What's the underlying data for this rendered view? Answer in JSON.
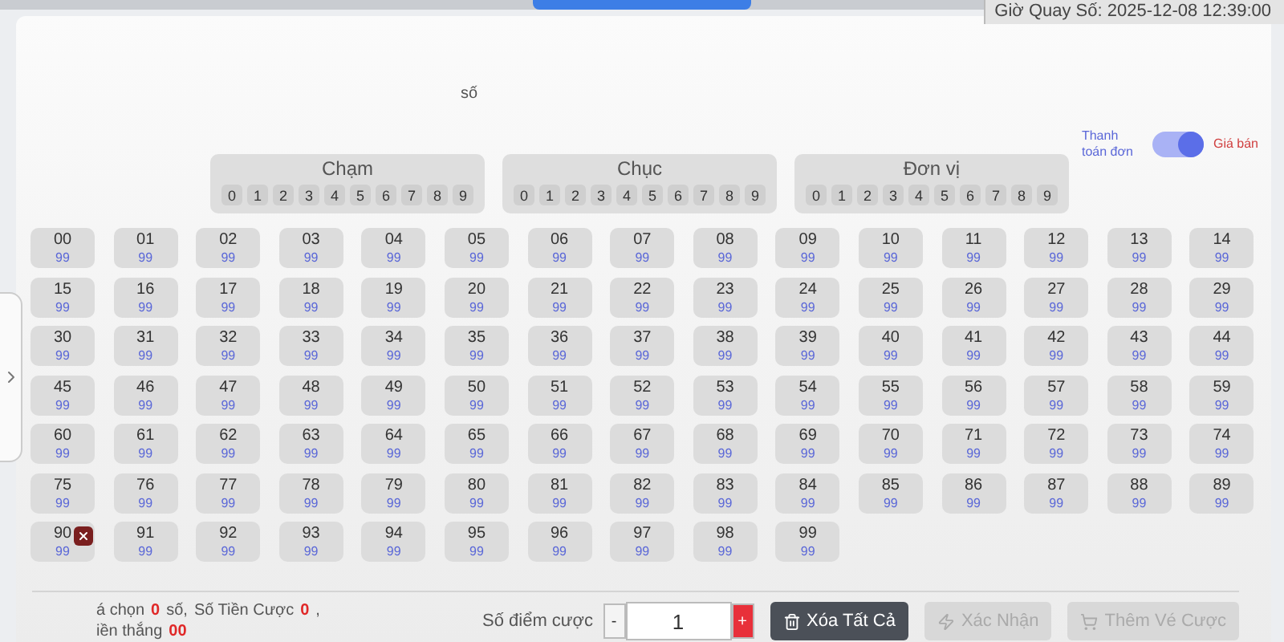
{
  "draw_time": "Giờ Quay Số: 2025-12-08 12:39:00",
  "partial_label": "số",
  "toggle": {
    "left_label": "Thanh toán đơn",
    "right_label": "Giá bán",
    "on": true
  },
  "groups": [
    {
      "title": "Chạm",
      "digits": [
        "0",
        "1",
        "2",
        "3",
        "4",
        "5",
        "6",
        "7",
        "8",
        "9"
      ]
    },
    {
      "title": "Chục",
      "digits": [
        "0",
        "1",
        "2",
        "3",
        "4",
        "5",
        "6",
        "7",
        "8",
        "9"
      ]
    },
    {
      "title": "Đơn vị",
      "digits": [
        "0",
        "1",
        "2",
        "3",
        "4",
        "5",
        "6",
        "7",
        "8",
        "9"
      ]
    }
  ],
  "cells": [
    {
      "number": "00",
      "value": "99",
      "removable": false
    },
    {
      "number": "01",
      "value": "99",
      "removable": false
    },
    {
      "number": "02",
      "value": "99",
      "removable": false
    },
    {
      "number": "03",
      "value": "99",
      "removable": false
    },
    {
      "number": "04",
      "value": "99",
      "removable": false
    },
    {
      "number": "05",
      "value": "99",
      "removable": false
    },
    {
      "number": "06",
      "value": "99",
      "removable": false
    },
    {
      "number": "07",
      "value": "99",
      "removable": false
    },
    {
      "number": "08",
      "value": "99",
      "removable": false
    },
    {
      "number": "09",
      "value": "99",
      "removable": false
    },
    {
      "number": "10",
      "value": "99",
      "removable": false
    },
    {
      "number": "11",
      "value": "99",
      "removable": false
    },
    {
      "number": "12",
      "value": "99",
      "removable": false
    },
    {
      "number": "13",
      "value": "99",
      "removable": false
    },
    {
      "number": "14",
      "value": "99",
      "removable": false
    },
    {
      "number": "15",
      "value": "99",
      "removable": false
    },
    {
      "number": "16",
      "value": "99",
      "removable": false
    },
    {
      "number": "17",
      "value": "99",
      "removable": false
    },
    {
      "number": "18",
      "value": "99",
      "removable": false
    },
    {
      "number": "19",
      "value": "99",
      "removable": false
    },
    {
      "number": "20",
      "value": "99",
      "removable": false
    },
    {
      "number": "21",
      "value": "99",
      "removable": false
    },
    {
      "number": "22",
      "value": "99",
      "removable": false
    },
    {
      "number": "23",
      "value": "99",
      "removable": false
    },
    {
      "number": "24",
      "value": "99",
      "removable": false
    },
    {
      "number": "25",
      "value": "99",
      "removable": false
    },
    {
      "number": "26",
      "value": "99",
      "removable": false
    },
    {
      "number": "27",
      "value": "99",
      "removable": false
    },
    {
      "number": "28",
      "value": "99",
      "removable": false
    },
    {
      "number": "29",
      "value": "99",
      "removable": false
    },
    {
      "number": "30",
      "value": "99",
      "removable": false
    },
    {
      "number": "31",
      "value": "99",
      "removable": false
    },
    {
      "number": "32",
      "value": "99",
      "removable": false
    },
    {
      "number": "33",
      "value": "99",
      "removable": false
    },
    {
      "number": "34",
      "value": "99",
      "removable": false
    },
    {
      "number": "35",
      "value": "99",
      "removable": false
    },
    {
      "number": "36",
      "value": "99",
      "removable": false
    },
    {
      "number": "37",
      "value": "99",
      "removable": false
    },
    {
      "number": "38",
      "value": "99",
      "removable": false
    },
    {
      "number": "39",
      "value": "99",
      "removable": false
    },
    {
      "number": "40",
      "value": "99",
      "removable": false
    },
    {
      "number": "41",
      "value": "99",
      "removable": false
    },
    {
      "number": "42",
      "value": "99",
      "removable": false
    },
    {
      "number": "43",
      "value": "99",
      "removable": false
    },
    {
      "number": "44",
      "value": "99",
      "removable": false
    },
    {
      "number": "45",
      "value": "99",
      "removable": false
    },
    {
      "number": "46",
      "value": "99",
      "removable": false
    },
    {
      "number": "47",
      "value": "99",
      "removable": false
    },
    {
      "number": "48",
      "value": "99",
      "removable": false
    },
    {
      "number": "49",
      "value": "99",
      "removable": false
    },
    {
      "number": "50",
      "value": "99",
      "removable": false
    },
    {
      "number": "51",
      "value": "99",
      "removable": false
    },
    {
      "number": "52",
      "value": "99",
      "removable": false
    },
    {
      "number": "53",
      "value": "99",
      "removable": false
    },
    {
      "number": "54",
      "value": "99",
      "removable": false
    },
    {
      "number": "55",
      "value": "99",
      "removable": false
    },
    {
      "number": "56",
      "value": "99",
      "removable": false
    },
    {
      "number": "57",
      "value": "99",
      "removable": false
    },
    {
      "number": "58",
      "value": "99",
      "removable": false
    },
    {
      "number": "59",
      "value": "99",
      "removable": false
    },
    {
      "number": "60",
      "value": "99",
      "removable": false
    },
    {
      "number": "61",
      "value": "99",
      "removable": false
    },
    {
      "number": "62",
      "value": "99",
      "removable": false
    },
    {
      "number": "63",
      "value": "99",
      "removable": false
    },
    {
      "number": "64",
      "value": "99",
      "removable": false
    },
    {
      "number": "65",
      "value": "99",
      "removable": false
    },
    {
      "number": "66",
      "value": "99",
      "removable": false
    },
    {
      "number": "67",
      "value": "99",
      "removable": false
    },
    {
      "number": "68",
      "value": "99",
      "removable": false
    },
    {
      "number": "69",
      "value": "99",
      "removable": false
    },
    {
      "number": "70",
      "value": "99",
      "removable": false
    },
    {
      "number": "71",
      "value": "99",
      "removable": false
    },
    {
      "number": "72",
      "value": "99",
      "removable": false
    },
    {
      "number": "73",
      "value": "99",
      "removable": false
    },
    {
      "number": "74",
      "value": "99",
      "removable": false
    },
    {
      "number": "75",
      "value": "99",
      "removable": false
    },
    {
      "number": "76",
      "value": "99",
      "removable": false
    },
    {
      "number": "77",
      "value": "99",
      "removable": false
    },
    {
      "number": "78",
      "value": "99",
      "removable": false
    },
    {
      "number": "79",
      "value": "99",
      "removable": false
    },
    {
      "number": "80",
      "value": "99",
      "removable": false
    },
    {
      "number": "81",
      "value": "99",
      "removable": false
    },
    {
      "number": "82",
      "value": "99",
      "removable": false
    },
    {
      "number": "83",
      "value": "99",
      "removable": false
    },
    {
      "number": "84",
      "value": "99",
      "removable": false
    },
    {
      "number": "85",
      "value": "99",
      "removable": false
    },
    {
      "number": "86",
      "value": "99",
      "removable": false
    },
    {
      "number": "87",
      "value": "99",
      "removable": false
    },
    {
      "number": "88",
      "value": "99",
      "removable": false
    },
    {
      "number": "89",
      "value": "99",
      "removable": false
    },
    {
      "number": "90",
      "value": "99",
      "removable": true
    },
    {
      "number": "91",
      "value": "99",
      "removable": false
    },
    {
      "number": "92",
      "value": "99",
      "removable": false
    },
    {
      "number": "93",
      "value": "99",
      "removable": false
    },
    {
      "number": "94",
      "value": "99",
      "removable": false
    },
    {
      "number": "95",
      "value": "99",
      "removable": false
    },
    {
      "number": "96",
      "value": "99",
      "removable": false
    },
    {
      "number": "97",
      "value": "99",
      "removable": false
    },
    {
      "number": "98",
      "value": "99",
      "removable": false
    },
    {
      "number": "99",
      "value": "99",
      "removable": false
    }
  ],
  "summary": {
    "line_1": [
      "á chọn",
      "0",
      "số,",
      "Số Tiền Cược",
      "0",
      ","
    ],
    "line_2": [
      "iền thắng",
      "00"
    ]
  },
  "bet": {
    "label": "Số điểm cược",
    "minus": "-",
    "value": "1",
    "plus": "+"
  },
  "buttons": [
    {
      "kind": "clear",
      "label": "Xóa Tất Cả",
      "disabled": false
    },
    {
      "kind": "confirm",
      "label": "Xác Nhận",
      "disabled": true
    },
    {
      "kind": "add",
      "label": "Thêm Vé Cược",
      "disabled": true
    }
  ]
}
